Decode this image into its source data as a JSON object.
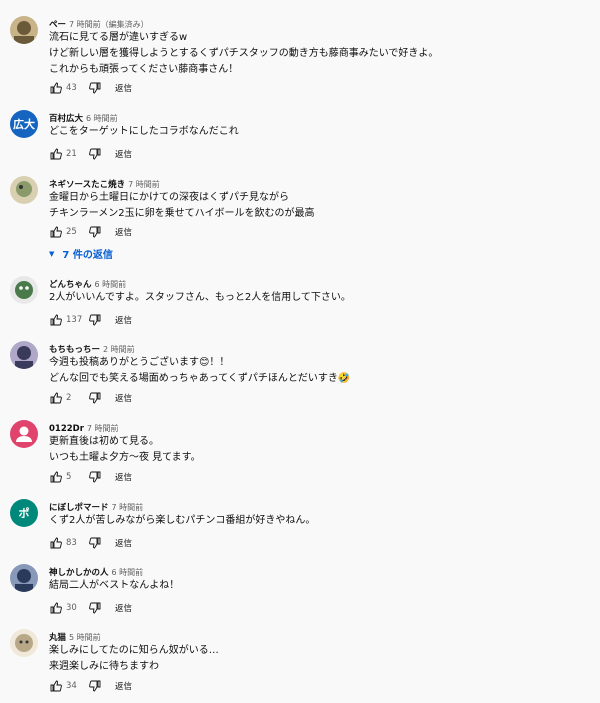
{
  "labels": {
    "reply": "返信"
  },
  "comments": [
    {
      "author": "ペー",
      "time": "7 時間前（編集済み）",
      "lines": [
        "流石に見てる層が違いすぎるw",
        "けど新しい層を獲得しようとするくずパチスタッフの動き方も藤商事みたいで好きよ。",
        "これからも頑張ってください藤商事さん！"
      ],
      "likes": "43",
      "avatar": {
        "type": "photo",
        "colors": [
          "#6b5a3a",
          "#c9b48a"
        ]
      }
    },
    {
      "author": "百村広大",
      "time": "6 時間前",
      "lines": [
        "どこをターゲットにしたコラボなんだこれ"
      ],
      "likes": "21",
      "avatar": {
        "type": "text",
        "text": "広大",
        "color": "#1565c0"
      }
    },
    {
      "author": "ネギソースたこ焼き",
      "time": "7 時間前",
      "lines": [
        "金曜日から土曜日にかけての深夜はくずパチ見ながら",
        "チキンラーメン2玉に卵を乗せてハイボールを飲むのが最高"
      ],
      "likes": "25",
      "replies_label": "7 件の返信",
      "avatar": {
        "type": "photo",
        "colors": [
          "#8a9a6a",
          "#d8d0b0"
        ]
      }
    },
    {
      "author": "どんちゃん",
      "time": "6 時間前",
      "lines": [
        "2人がいいんですよ。スタッフさん、もっと2人を信用して下さい。"
      ],
      "likes": "137",
      "avatar": {
        "type": "photo",
        "colors": [
          "#4a7a4a",
          "#e8e8e8"
        ]
      }
    },
    {
      "author": "もちもっちー",
      "time": "2 時間前",
      "lines": [
        "今週も投稿ありがとうございます😊！！",
        "どんな回でも笑える場面めっちゃあってくずパチほんとだいすき🤣"
      ],
      "likes": "2",
      "avatar": {
        "type": "photo",
        "colors": [
          "#3a3a5a",
          "#b0a8c8"
        ]
      }
    },
    {
      "author": "0122Dr",
      "time": "7 時間前",
      "lines": [
        "更新直後は初めて見る。",
        "いつも土曜よ夕方〜夜 見てます。"
      ],
      "likes": "5",
      "avatar": {
        "type": "person",
        "color": "#e0436b"
      }
    },
    {
      "author": "にぼしポマード",
      "time": "7 時間前",
      "lines": [
        "くず2人が苦しみながら楽しむパチンコ番組が好きやねん。"
      ],
      "likes": "83",
      "avatar": {
        "type": "text",
        "text": "ポ",
        "color": "#00897b"
      }
    },
    {
      "author": "神しかしかの人",
      "time": "6 時間前",
      "lines": [
        "結局二人がベストなんよね！"
      ],
      "likes": "30",
      "avatar": {
        "type": "photo",
        "colors": [
          "#2a3a5a",
          "#8898b8"
        ]
      }
    },
    {
      "author": "丸猫",
      "time": "5 時間前",
      "lines": [
        "楽しみにしてたのに知らん奴がいる…",
        "来週楽しみに待ちますわ"
      ],
      "likes": "34",
      "avatar": {
        "type": "photo",
        "colors": [
          "#b8a888",
          "#f0e8d8"
        ]
      }
    }
  ]
}
